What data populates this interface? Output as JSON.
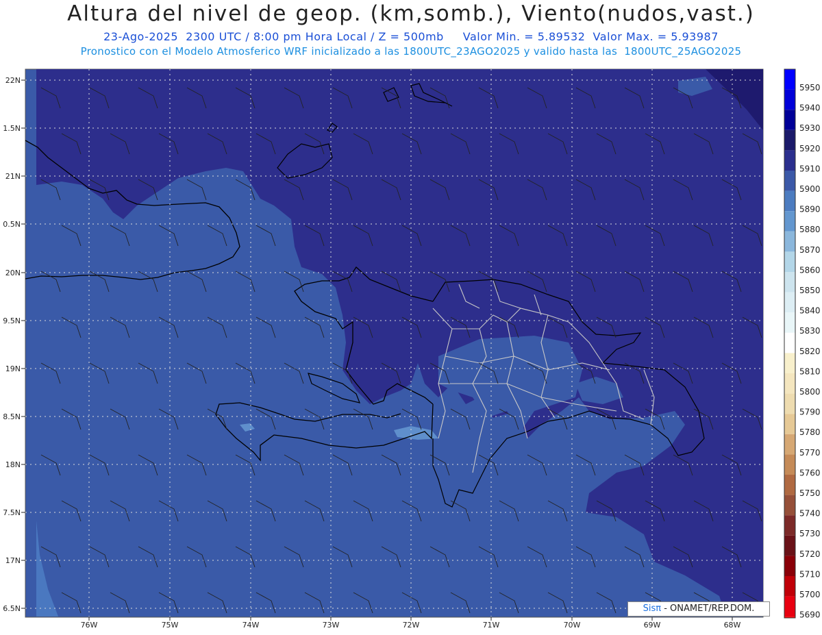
{
  "header": {
    "title": "Altura del nivel de geop. (km,somb.), Viento(nudos,vast.)",
    "line1": "23-Ago-2025  2300 UTC / 8:00 pm Hora Local / Z = 500mb     Valor Min. = 5.89532  Valor Max. = 5.93987",
    "line2": "Pronostico con el Modelo Atmosferico WRF inicializado a las 1800UTC_23AGO2025 y valido hasta las  1800UTC_25AGO2025"
  },
  "map": {
    "lat_labels": [
      "22N",
      "1.5N",
      "21N",
      "0.5N",
      "20N",
      "9.5N",
      "19N",
      "8.5N",
      "18N",
      "7.5N",
      "17N",
      "6.5N"
    ],
    "lon_labels": [
      "76W",
      "75W",
      "74W",
      "73W",
      "72W",
      "71W",
      "70W",
      "69W",
      "68W"
    ],
    "colors": {
      "level_5900": "#3a5aa8",
      "level_5910": "#2d2e8c",
      "level_5920": "#1e1a6e",
      "level_5890": "#4a78c0",
      "level_5880": "#5f8fcc"
    }
  },
  "colorbar": {
    "levels": [
      "5950",
      "5940",
      "5930",
      "5920",
      "5910",
      "5900",
      "5890",
      "5880",
      "5870",
      "5860",
      "5850",
      "5840",
      "5830",
      "5820",
      "5810",
      "5800",
      "5790",
      "5780",
      "5770",
      "5760",
      "5750",
      "5740",
      "5730",
      "5720",
      "5710",
      "5700",
      "5690"
    ],
    "colors": [
      "#0000ff",
      "#0000d8",
      "#000098",
      "#1b1a6a",
      "#2b2f8e",
      "#3b59a8",
      "#4c7cc0",
      "#6397cf",
      "#8bb7dc",
      "#b3d6e8",
      "#cde4ee",
      "#ddeef4",
      "#e9f6f8",
      "#ffffff",
      "#f8f0cc",
      "#f4e6bf",
      "#eedcb0",
      "#e6c996",
      "#d6a874",
      "#c58b58",
      "#b06a42",
      "#965039",
      "#7c2a28",
      "#6a1218",
      "#8a0008",
      "#c00008",
      "#e80010"
    ]
  },
  "credit": {
    "brand": "Sisπ",
    "text": " - ONAMET/REP.DOM."
  }
}
